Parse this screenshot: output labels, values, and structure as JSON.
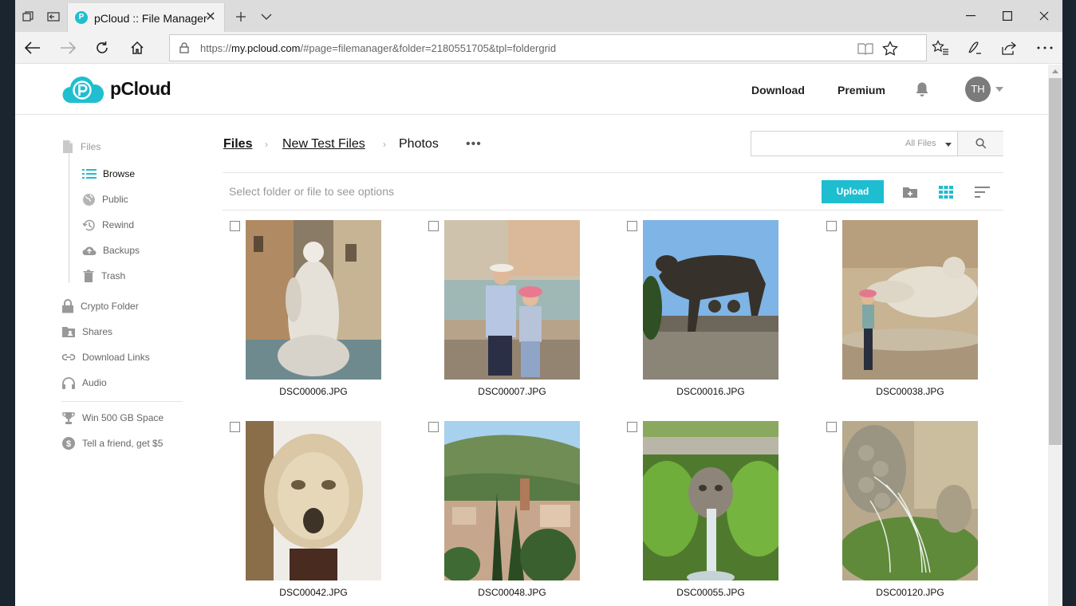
{
  "browser": {
    "tab_title": "pCloud :: File Manager",
    "favicon_letter": "P",
    "url_prefix": "https://",
    "url_domain": "my.pcloud.com",
    "url_rest": "/#page=filemanager&folder=2180551705&tpl=foldergrid"
  },
  "header": {
    "logo_text": "pCloud",
    "download_label": "Download",
    "premium_label": "Premium",
    "avatar_initials": "TH"
  },
  "sidebar": {
    "files_label": "Files",
    "browse_label": "Browse",
    "public_label": "Public",
    "rewind_label": "Rewind",
    "backups_label": "Backups",
    "trash_label": "Trash",
    "crypto_label": "Crypto Folder",
    "shares_label": "Shares",
    "download_links_label": "Download Links",
    "audio_label": "Audio",
    "win_label": "Win 500 GB Space",
    "tell_label": "Tell a friend, get $5"
  },
  "breadcrumb": {
    "root": "Files",
    "middle": "New Test Files",
    "current": "Photos",
    "more": "•••"
  },
  "search": {
    "placeholder": "",
    "filter": "All Files"
  },
  "optbar": {
    "hint": "Select folder or file to see options",
    "upload_label": "Upload"
  },
  "files": [
    {
      "name": "DSC00006.JPG"
    },
    {
      "name": "DSC00007.JPG"
    },
    {
      "name": "DSC00016.JPG"
    },
    {
      "name": "DSC00038.JPG"
    },
    {
      "name": "DSC00042.JPG"
    },
    {
      "name": "DSC00048.JPG"
    },
    {
      "name": "DSC00055.JPG"
    },
    {
      "name": "DSC00120.JPG"
    }
  ],
  "colors": {
    "accent": "#1ebdd0",
    "active_icon": "#1ebdd0"
  }
}
